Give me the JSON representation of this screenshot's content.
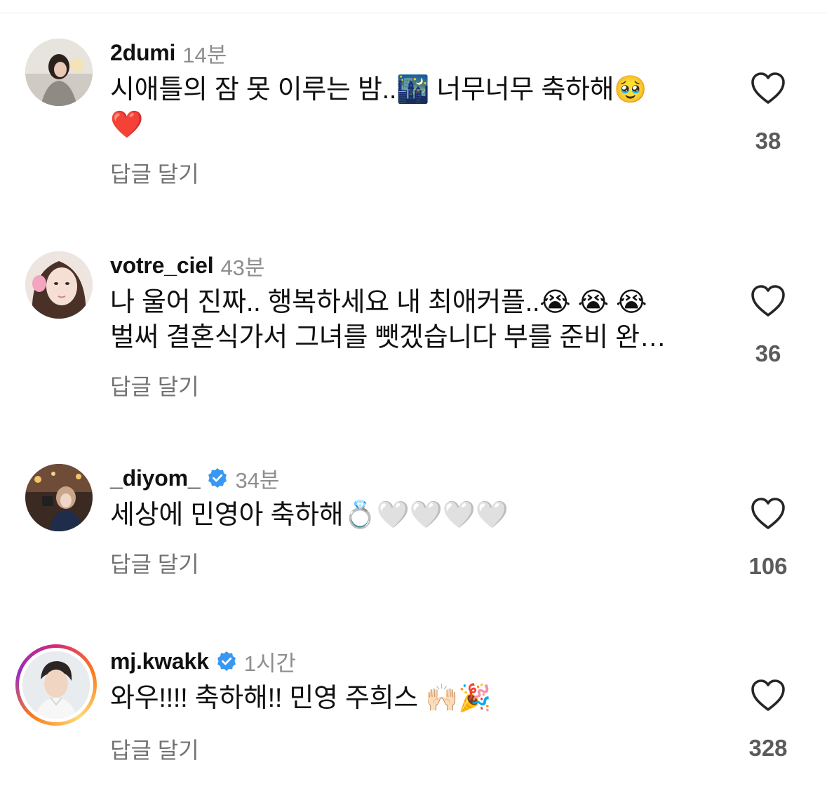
{
  "reply_label": "답글 달기",
  "colors": {
    "username": "#111111",
    "time": "#8e8e8e",
    "reply": "#737373",
    "like_count": "#5b5b5b",
    "verified_badge": "#3897f0",
    "story_ring": [
      "#d62976",
      "#fa7e1e",
      "#feda75",
      "#962fbf"
    ]
  },
  "comments": [
    {
      "username": "2dumi",
      "time": "14분",
      "verified": false,
      "line1": "시애틀의 잠 못 이루는 밤..🌃 너무너무 축하해🥹",
      "line2": "❤️",
      "likes": "38",
      "avatar": "avatar-2dumi"
    },
    {
      "username": "votre_ciel",
      "time": "43분",
      "verified": false,
      "line1": "나 울어 진짜.. 행복하세요 내 최애커플..😭 😭 😭",
      "line2": "벌써 결혼식가서 그녀를 뺏겠습니다 부를 준비 완…",
      "likes": "36",
      "avatar": "avatar-votre-ciel"
    },
    {
      "username": "_diyom_",
      "time": "34분",
      "verified": true,
      "line1": "세상에 민영아 축하해💍🤍🤍🤍🤍",
      "line2": "",
      "likes": "106",
      "avatar": "avatar-diyom"
    },
    {
      "username": "mj.kwakk",
      "time": "1시간",
      "verified": true,
      "line1": "와우!!!! 축하해!! 민영 주희스 🙌🏻🎉",
      "line2": "",
      "likes": "328",
      "avatar": "avatar-mj-kwakk"
    }
  ]
}
